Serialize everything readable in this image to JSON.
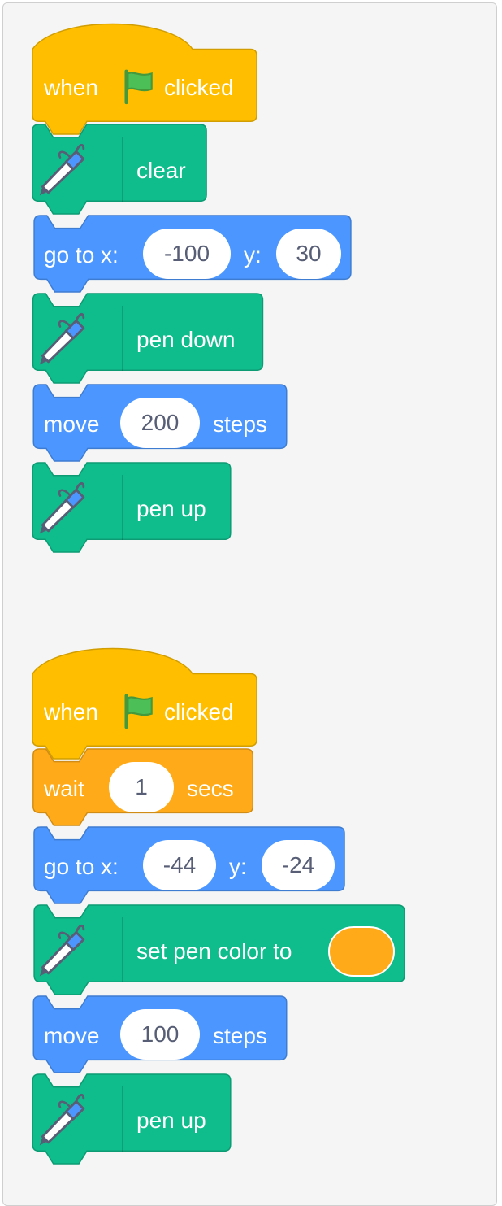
{
  "colors": {
    "events": "#ffbf00",
    "pen": "#0fbd8c",
    "motion": "#4c97ff",
    "control": "#ffab19",
    "pen_color_value": "#ffab19"
  },
  "scripts": [
    {
      "blocks": [
        {
          "type": "hat",
          "category": "events",
          "before": "when",
          "icon": "green-flag-icon",
          "after": "clicked"
        },
        {
          "type": "pen",
          "category": "pen",
          "icon": "pen-icon",
          "label": "clear"
        },
        {
          "type": "goto",
          "category": "motion",
          "label": "go to x:",
          "x": "-100",
          "label2": "y:",
          "y": "30"
        },
        {
          "type": "pen",
          "category": "pen",
          "icon": "pen-icon",
          "label": "pen down"
        },
        {
          "type": "move",
          "category": "motion",
          "label": "move",
          "steps": "200",
          "unit": "steps"
        },
        {
          "type": "pen",
          "category": "pen",
          "icon": "pen-icon",
          "label": "pen up"
        }
      ]
    },
    {
      "blocks": [
        {
          "type": "hat",
          "category": "events",
          "before": "when",
          "icon": "green-flag-icon",
          "after": "clicked"
        },
        {
          "type": "wait",
          "category": "control",
          "label": "wait",
          "secs": "1",
          "unit": "secs"
        },
        {
          "type": "goto",
          "category": "motion",
          "label": "go to x:",
          "x": "-44",
          "label2": "y:",
          "y": "-24"
        },
        {
          "type": "pencolor",
          "category": "pen",
          "icon": "pen-icon",
          "label": "set pen color to",
          "color": "#ffab19"
        },
        {
          "type": "move",
          "category": "motion",
          "label": "move",
          "steps": "100",
          "unit": "steps"
        },
        {
          "type": "pen",
          "category": "pen",
          "icon": "pen-icon",
          "label": "pen up"
        }
      ]
    }
  ]
}
